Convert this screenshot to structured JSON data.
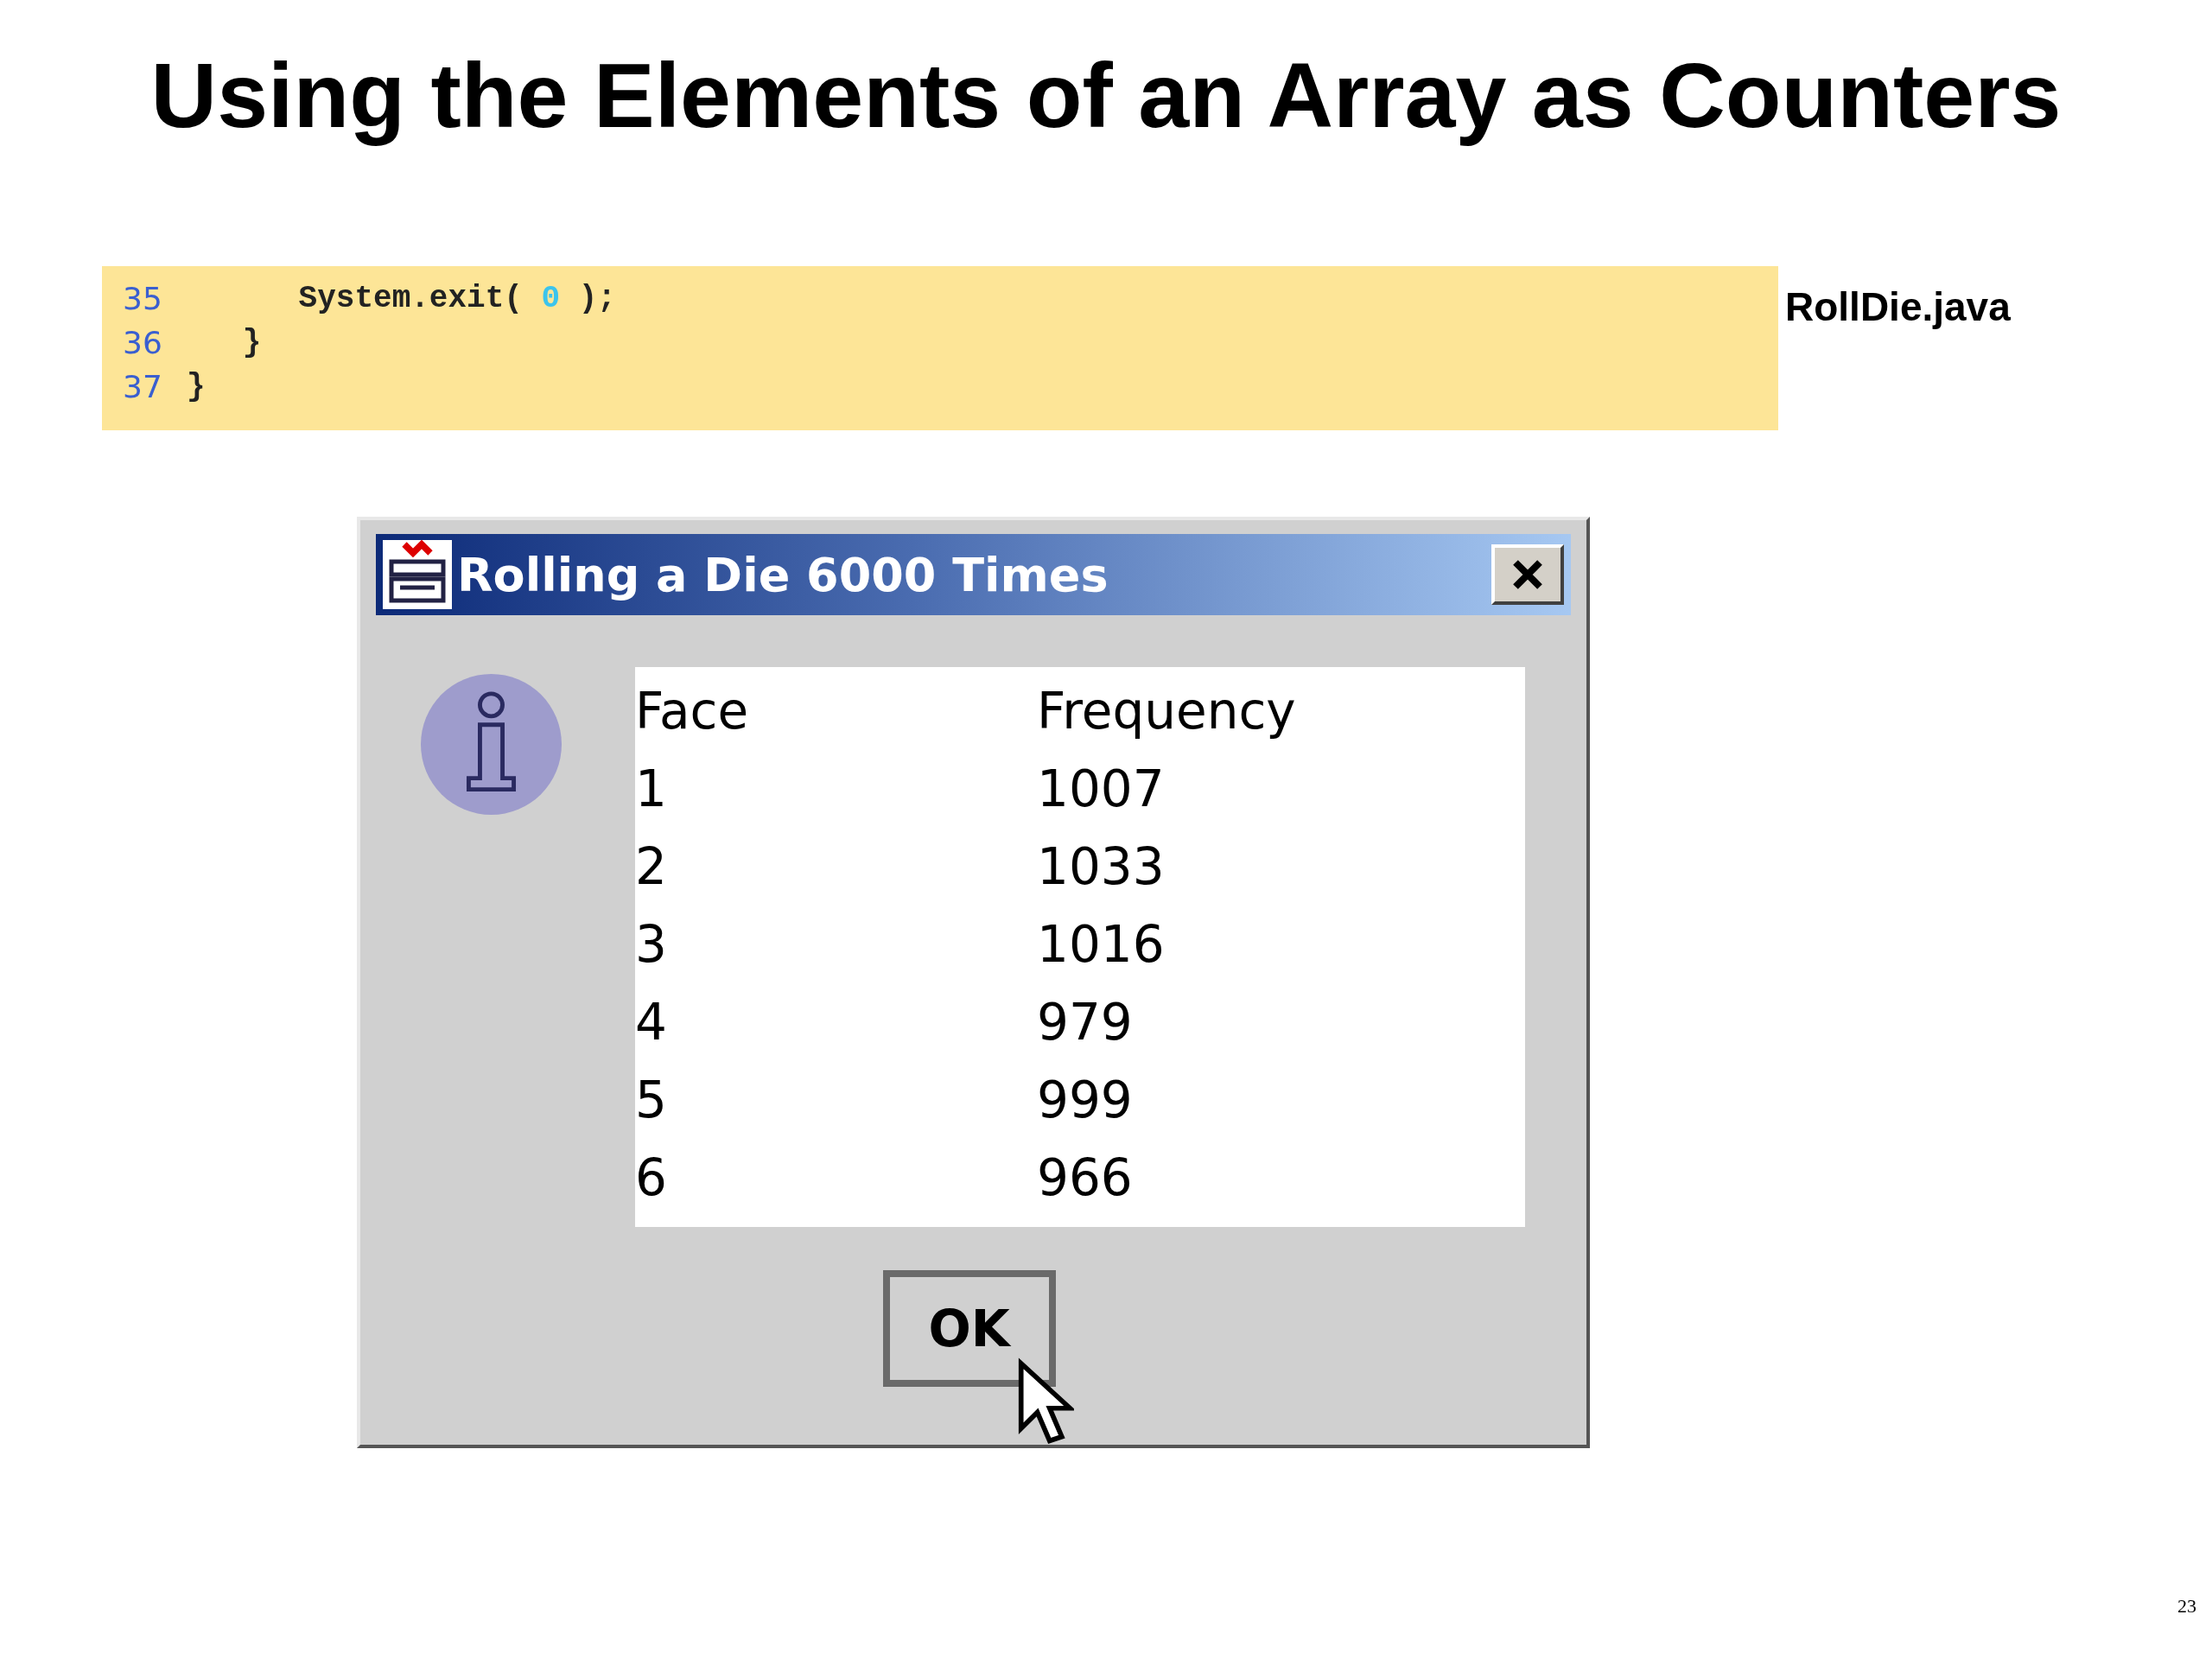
{
  "slide": {
    "title": "Using the Elements of an Array as Counters",
    "file_label": "RollDie.java",
    "page_number": "23"
  },
  "code": [
    {
      "number": "35",
      "parts": [
        {
          "kind": "plain",
          "text": "      System.exit( "
        },
        {
          "kind": "literal",
          "text": "0"
        },
        {
          "kind": "plain",
          "text": " );"
        }
      ]
    },
    {
      "number": "36",
      "parts": [
        {
          "kind": "plain",
          "text": "   }"
        }
      ]
    },
    {
      "number": "37",
      "parts": [
        {
          "kind": "plain",
          "text": "}"
        }
      ]
    }
  ],
  "dialog": {
    "title": "Rolling a Die 6000 Times",
    "table": {
      "columns": [
        "Face",
        "Frequency"
      ],
      "rows": [
        [
          "1",
          "1007"
        ],
        [
          "2",
          "1033"
        ],
        [
          "3",
          "1016"
        ],
        [
          "4",
          "979"
        ],
        [
          "5",
          "999"
        ],
        [
          "6",
          "966"
        ]
      ]
    },
    "button": "OK"
  }
}
